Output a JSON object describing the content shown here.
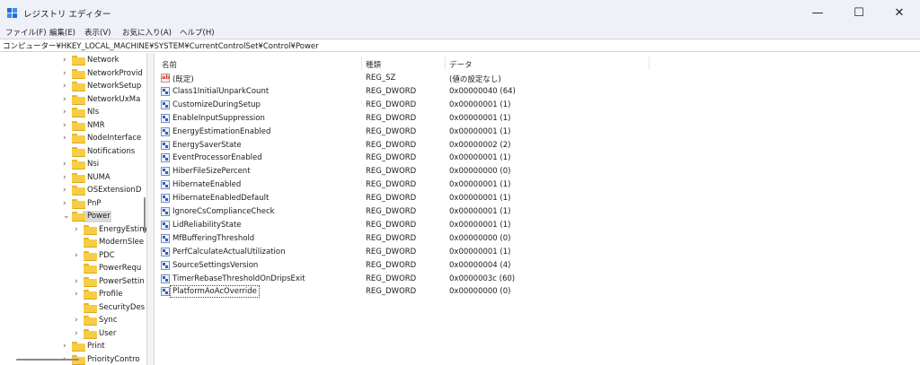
{
  "window": {
    "title": "レジストリ エディター",
    "controls": {
      "minimize": "—",
      "maximize": "☐",
      "close": "✕"
    }
  },
  "menu": [
    "ファイル(F)",
    "編集(E)",
    "表示(V)",
    "お気に入り(A)",
    "ヘルプ(H)"
  ],
  "address": "コンピューター¥HKEY_LOCAL_MACHINE¥SYSTEM¥CurrentControlSet¥Control¥Power",
  "tree": {
    "items": [
      {
        "label": "Network",
        "level": 0,
        "chevron": "›"
      },
      {
        "label": "NetworkProvid",
        "level": 0,
        "chevron": "›"
      },
      {
        "label": "NetworkSetup",
        "level": 0,
        "chevron": "›"
      },
      {
        "label": "NetworkUxMa",
        "level": 0,
        "chevron": "›"
      },
      {
        "label": "Nls",
        "level": 0,
        "chevron": "›"
      },
      {
        "label": "NMR",
        "level": 0,
        "chevron": "›"
      },
      {
        "label": "NodeInterface",
        "level": 0,
        "chevron": "›"
      },
      {
        "label": "Notifications",
        "level": 0,
        "chevron": ""
      },
      {
        "label": "Nsi",
        "level": 0,
        "chevron": "›"
      },
      {
        "label": "NUMA",
        "level": 0,
        "chevron": "›"
      },
      {
        "label": "OSExtensionD",
        "level": 0,
        "chevron": "›"
      },
      {
        "label": "PnP",
        "level": 0,
        "chevron": "›"
      },
      {
        "label": "Power",
        "level": 0,
        "chevron": "⌄",
        "selected": true
      },
      {
        "label": "EnergyEstim",
        "level": 1,
        "chevron": "›"
      },
      {
        "label": "ModernSlee",
        "level": 1,
        "chevron": ""
      },
      {
        "label": "PDC",
        "level": 1,
        "chevron": "›"
      },
      {
        "label": "PowerRequ",
        "level": 1,
        "chevron": ""
      },
      {
        "label": "PowerSettin",
        "level": 1,
        "chevron": "›"
      },
      {
        "label": "Profile",
        "level": 1,
        "chevron": "›"
      },
      {
        "label": "SecurityDes",
        "level": 1,
        "chevron": ""
      },
      {
        "label": "Sync",
        "level": 1,
        "chevron": "›"
      },
      {
        "label": "User",
        "level": 1,
        "chevron": "›"
      },
      {
        "label": "Print",
        "level": 0,
        "chevron": "›"
      },
      {
        "label": "PriorityContro",
        "level": 0,
        "chevron": "›"
      }
    ]
  },
  "list": {
    "headers": {
      "name": "名前",
      "type": "種類",
      "data": "データ"
    },
    "rows": [
      {
        "name": "(既定)",
        "type": "REG_SZ",
        "data": "(値の設定なし)",
        "icon": "string-value-icon"
      },
      {
        "name": "Class1InitialUnparkCount",
        "type": "REG_DWORD",
        "data": "0x00000040 (64)",
        "icon": "binary-value-icon"
      },
      {
        "name": "CustomizeDuringSetup",
        "type": "REG_DWORD",
        "data": "0x00000001 (1)",
        "icon": "binary-value-icon"
      },
      {
        "name": "EnableInputSuppression",
        "type": "REG_DWORD",
        "data": "0x00000001 (1)",
        "icon": "binary-value-icon"
      },
      {
        "name": "EnergyEstimationEnabled",
        "type": "REG_DWORD",
        "data": "0x00000001 (1)",
        "icon": "binary-value-icon"
      },
      {
        "name": "EnergySaverState",
        "type": "REG_DWORD",
        "data": "0x00000002 (2)",
        "icon": "binary-value-icon"
      },
      {
        "name": "EventProcessorEnabled",
        "type": "REG_DWORD",
        "data": "0x00000001 (1)",
        "icon": "binary-value-icon"
      },
      {
        "name": "HiberFileSizePercent",
        "type": "REG_DWORD",
        "data": "0x00000000 (0)",
        "icon": "binary-value-icon"
      },
      {
        "name": "HibernateEnabled",
        "type": "REG_DWORD",
        "data": "0x00000001 (1)",
        "icon": "binary-value-icon"
      },
      {
        "name": "HibernateEnabledDefault",
        "type": "REG_DWORD",
        "data": "0x00000001 (1)",
        "icon": "binary-value-icon"
      },
      {
        "name": "IgnoreCsComplianceCheck",
        "type": "REG_DWORD",
        "data": "0x00000001 (1)",
        "icon": "binary-value-icon"
      },
      {
        "name": "LidReliabilityState",
        "type": "REG_DWORD",
        "data": "0x00000001 (1)",
        "icon": "binary-value-icon"
      },
      {
        "name": "MfBufferingThreshold",
        "type": "REG_DWORD",
        "data": "0x00000000 (0)",
        "icon": "binary-value-icon"
      },
      {
        "name": "PerfCalculateActualUtilization",
        "type": "REG_DWORD",
        "data": "0x00000001 (1)",
        "icon": "binary-value-icon"
      },
      {
        "name": "SourceSettingsVersion",
        "type": "REG_DWORD",
        "data": "0x00000004 (4)",
        "icon": "binary-value-icon"
      },
      {
        "name": "TimerRebaseThresholdOnDripsExit",
        "type": "REG_DWORD",
        "data": "0x0000003c (60)",
        "icon": "binary-value-icon"
      },
      {
        "name": "PlatformAoAcOverride",
        "type": "REG_DWORD",
        "data": "0x00000000 (0)",
        "icon": "binary-value-icon",
        "focused": true
      }
    ]
  }
}
